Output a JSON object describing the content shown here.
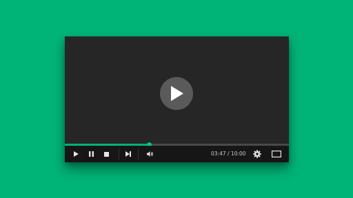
{
  "player": {
    "current_time": "03:47",
    "time_separator": " / ",
    "duration": "10:00",
    "progress": 0.3783,
    "accent_color": "#00b377",
    "background_color": "#00b377"
  },
  "icons": {
    "big_play": "play-icon",
    "play": "play-icon",
    "pause": "pause-icon",
    "stop": "stop-icon",
    "next": "skip-next-icon",
    "volume": "volume-icon",
    "settings": "gear-icon",
    "fullscreen": "fullscreen-icon"
  }
}
